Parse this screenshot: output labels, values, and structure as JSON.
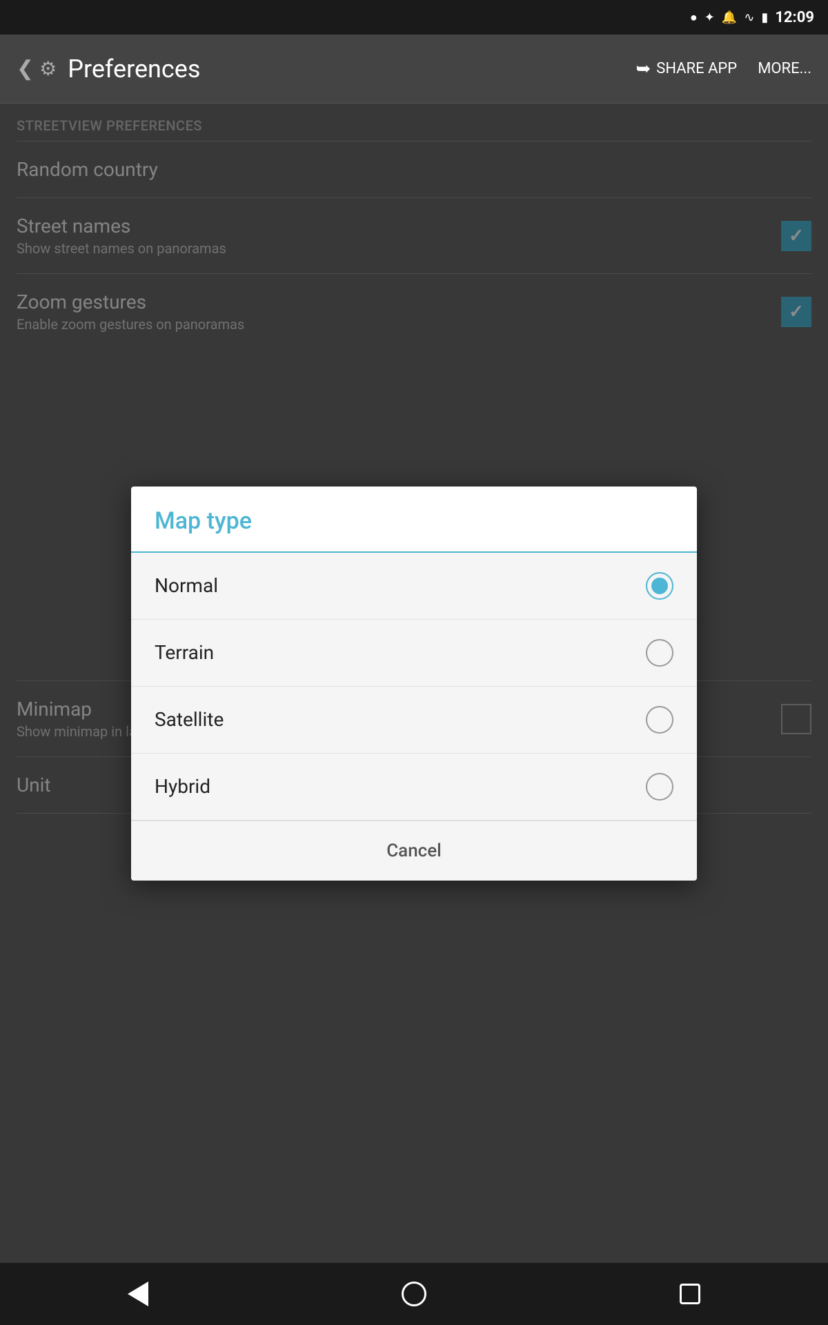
{
  "statusBar": {
    "time": "12:09",
    "icons": [
      "location",
      "bluetooth",
      "notification",
      "wifi",
      "battery"
    ]
  },
  "appBar": {
    "title": "Preferences",
    "shareLabel": "SHARE APP",
    "moreLabel": "MORE..."
  },
  "preferences": {
    "sectionHeader": "STREETVIEW PREFERENCES",
    "items": [
      {
        "id": "random-country",
        "title": "Random country",
        "subtitle": "",
        "hasCheckbox": false,
        "checked": false
      },
      {
        "id": "street-names",
        "title": "Street names",
        "subtitle": "Show street names on panoramas",
        "hasCheckbox": true,
        "checked": true
      },
      {
        "id": "zoom-gestures",
        "title": "Zoom gestures",
        "subtitle": "Enable zoom gestures on panoramas",
        "hasCheckbox": true,
        "checked": true
      }
    ],
    "belowItems": [
      {
        "id": "minimap",
        "title": "Minimap",
        "subtitle": "Show minimap in landscape mode",
        "hasCheckbox": true,
        "checked": false
      },
      {
        "id": "unit",
        "title": "Unit",
        "subtitle": "",
        "hasCheckbox": false,
        "checked": false
      }
    ]
  },
  "dialog": {
    "title": "Map type",
    "options": [
      {
        "id": "normal",
        "label": "Normal",
        "selected": true
      },
      {
        "id": "terrain",
        "label": "Terrain",
        "selected": false
      },
      {
        "id": "satellite",
        "label": "Satellite",
        "selected": false
      },
      {
        "id": "hybrid",
        "label": "Hybrid",
        "selected": false
      }
    ],
    "cancelLabel": "Cancel"
  },
  "navBar": {
    "backTitle": "Back",
    "homeTitle": "Home",
    "recentsTitle": "Recents"
  },
  "colors": {
    "accent": "#4db6d4",
    "background": "#666666",
    "appBar": "#444444",
    "statusBar": "#1a1a1a",
    "navBar": "#1a1a1a",
    "dialogBg": "#ffffff",
    "optionBg": "#f5f5f5"
  }
}
